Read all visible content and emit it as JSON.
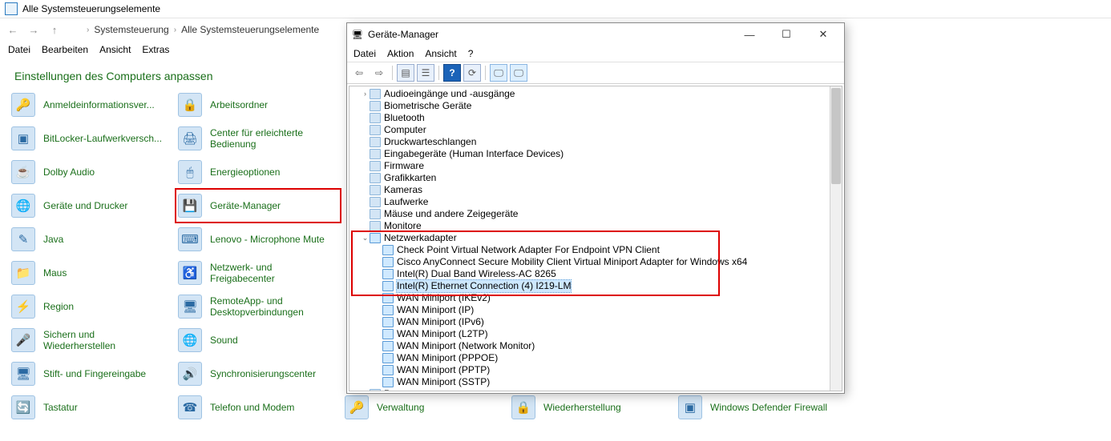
{
  "control_panel": {
    "title": "Alle Systemsteuerungselemente",
    "breadcrumb": [
      "Systemsteuerung",
      "Alle Systemsteuerungselemente"
    ],
    "menu": [
      "Datei",
      "Bearbeiten",
      "Ansicht",
      "Extras"
    ],
    "heading": "Einstellungen des Computers anpassen",
    "items_col1": [
      "Anmeldeinformationsver...",
      "BitLocker-Laufwerkversch...",
      "Dolby Audio",
      "Geräte und Drucker",
      "Java",
      "Maus",
      "Region",
      "Sichern und Wiederherstellen",
      "Stift- und Fingereingabe",
      "Tastatur"
    ],
    "items_col2": [
      "Arbeitsordner",
      "Center für erleichterte Bedienung",
      "Energieoptionen",
      "Geräte-Manager",
      "Lenovo - Microphone Mute",
      "Netzwerk- und Freigabecenter",
      "RemoteApp- und Desktopverbindungen",
      "Sound",
      "Synchronisierungscenter",
      "Telefon und Modem"
    ],
    "items_bottom": [
      "Verwaltung",
      "Wiederherstellung",
      "Windows Defender Firewall"
    ],
    "highlight_index_col2": 3
  },
  "device_manager": {
    "title": "Geräte-Manager",
    "menu": [
      "Datei",
      "Aktion",
      "Ansicht",
      "?"
    ],
    "tree": [
      {
        "level": 1,
        "exp": ">",
        "label": "Audioeingänge und -ausgänge"
      },
      {
        "level": 1,
        "exp": "",
        "label": "Biometrische Geräte"
      },
      {
        "level": 1,
        "exp": "",
        "label": "Bluetooth"
      },
      {
        "level": 1,
        "exp": "",
        "label": "Computer"
      },
      {
        "level": 1,
        "exp": "",
        "label": "Druckwarteschlangen"
      },
      {
        "level": 1,
        "exp": "",
        "label": "Eingabegeräte (Human Interface Devices)"
      },
      {
        "level": 1,
        "exp": "",
        "label": "Firmware"
      },
      {
        "level": 1,
        "exp": "",
        "label": "Grafikkarten"
      },
      {
        "level": 1,
        "exp": "",
        "label": "Kameras"
      },
      {
        "level": 1,
        "exp": "",
        "label": "Laufwerke"
      },
      {
        "level": 1,
        "exp": "",
        "label": "Mäuse und andere Zeigegeräte"
      },
      {
        "level": 1,
        "exp": "",
        "label": "Monitore"
      },
      {
        "level": 1,
        "exp": "v",
        "label": "Netzwerkadapter",
        "net": true
      },
      {
        "level": 2,
        "exp": "",
        "label": "Check Point Virtual Network Adapter For Endpoint VPN Client",
        "net": true
      },
      {
        "level": 2,
        "exp": "",
        "label": "Cisco AnyConnect Secure Mobility Client Virtual Miniport Adapter for Windows x64",
        "net": true
      },
      {
        "level": 2,
        "exp": "",
        "label": "Intel(R) Dual Band Wireless-AC 8265",
        "net": true
      },
      {
        "level": 2,
        "exp": "",
        "label": "Intel(R) Ethernet Connection (4) I219-LM",
        "net": true,
        "selected": true
      },
      {
        "level": 2,
        "exp": "",
        "label": "WAN Miniport (IKEv2)",
        "net": true
      },
      {
        "level": 2,
        "exp": "",
        "label": "WAN Miniport (IP)",
        "net": true
      },
      {
        "level": 2,
        "exp": "",
        "label": "WAN Miniport (IPv6)",
        "net": true
      },
      {
        "level": 2,
        "exp": "",
        "label": "WAN Miniport (L2TP)",
        "net": true
      },
      {
        "level": 2,
        "exp": "",
        "label": "WAN Miniport (Network Monitor)",
        "net": true
      },
      {
        "level": 2,
        "exp": "",
        "label": "WAN Miniport (PPPOE)",
        "net": true
      },
      {
        "level": 2,
        "exp": "",
        "label": "WAN Miniport (PPTP)",
        "net": true
      },
      {
        "level": 2,
        "exp": "",
        "label": "WAN Miniport (SSTP)",
        "net": true
      },
      {
        "level": 1,
        "exp": ">",
        "label": "Prozessoren"
      }
    ]
  }
}
